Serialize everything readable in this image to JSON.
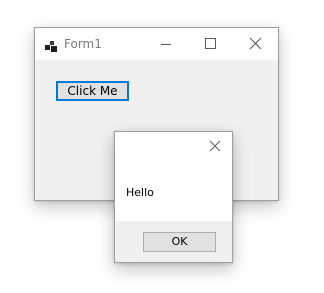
{
  "form": {
    "title": "Form1",
    "icon": "windows-form-app-icon",
    "controls": {
      "minimize": "minimize-icon",
      "maximize": "maximize-icon",
      "close": "close-icon"
    },
    "button_label": "Click Me",
    "background_color": "#f0f0f0",
    "focus_color": "#0078d7"
  },
  "message_box": {
    "text": "Hello",
    "ok_label": "OK",
    "close_icon": "close-icon",
    "footer_color": "#f0f0f0"
  }
}
